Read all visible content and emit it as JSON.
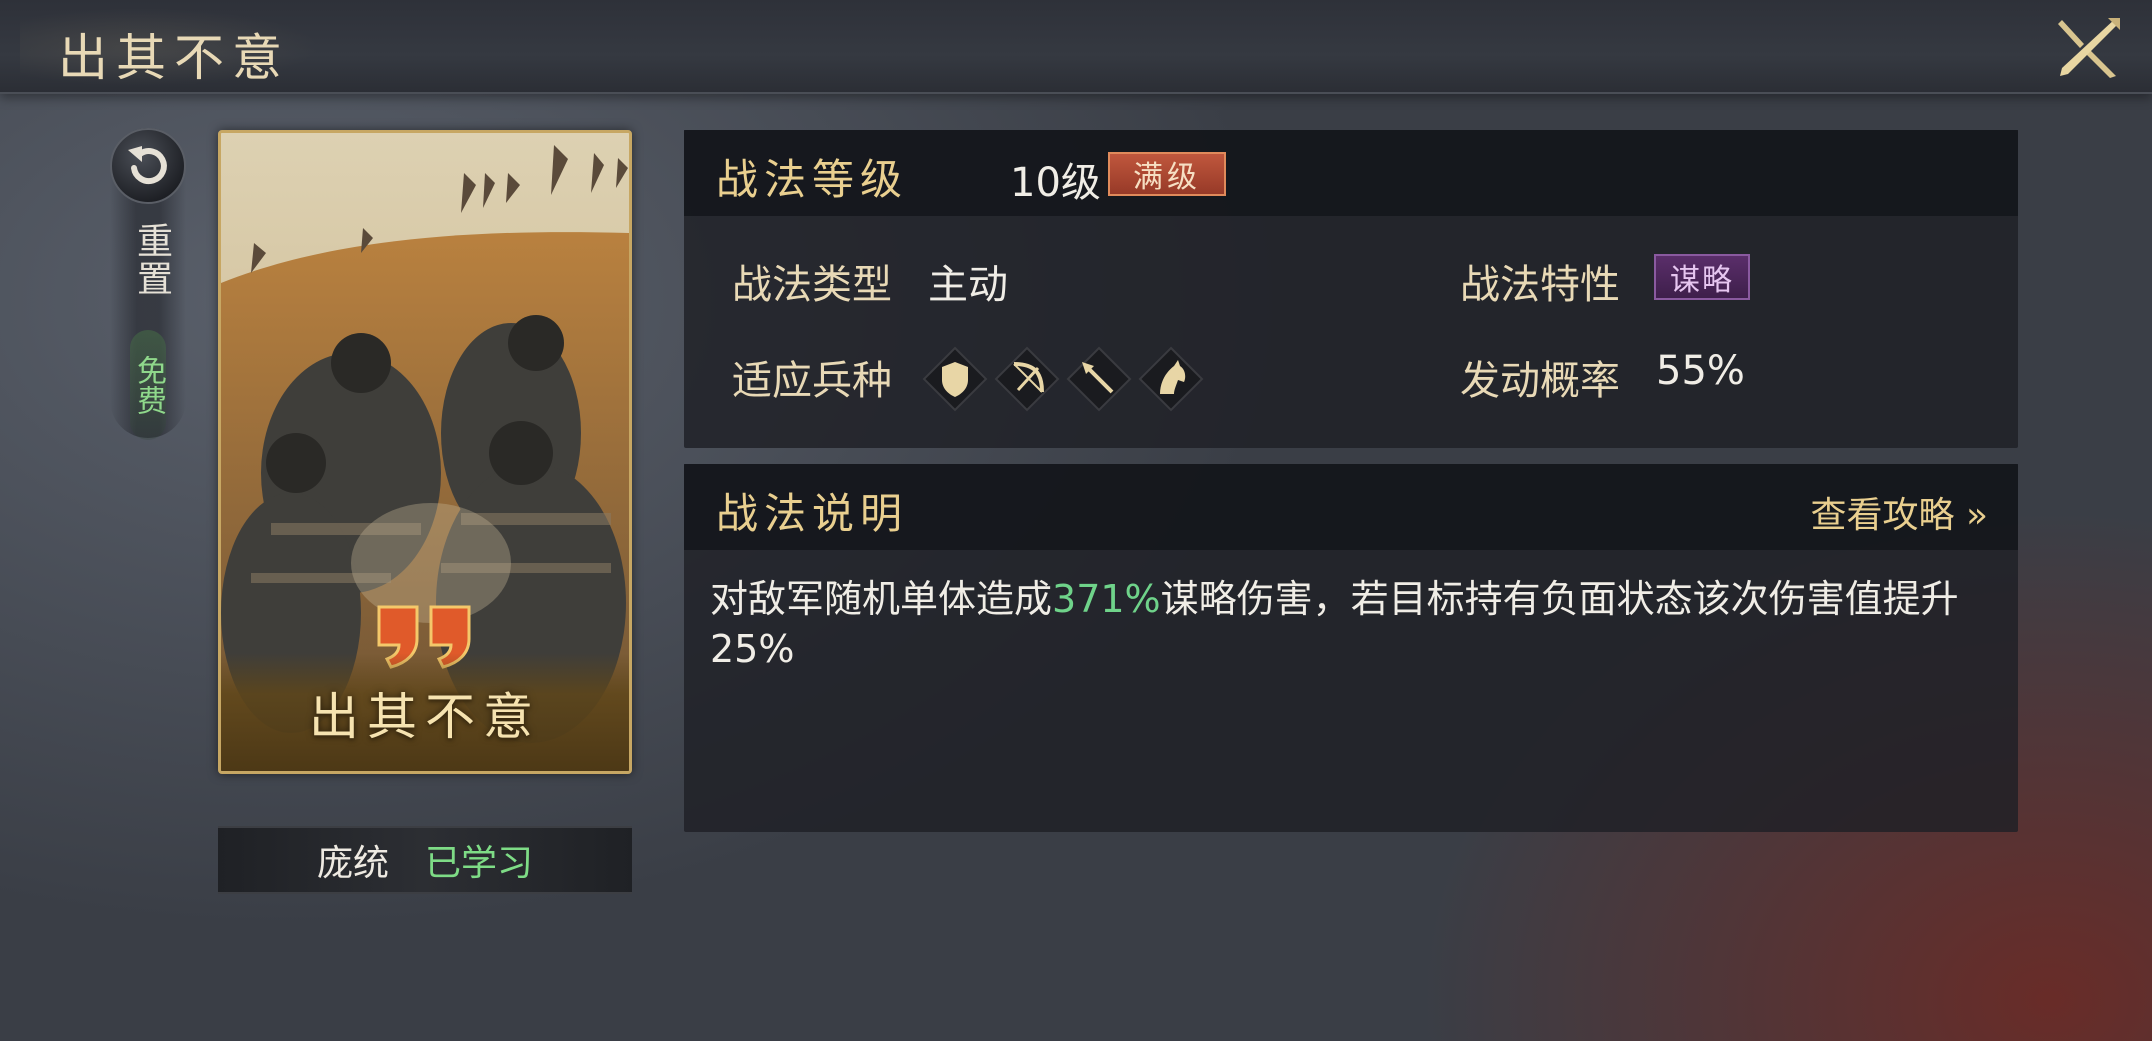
{
  "header": {
    "title": "出其不意"
  },
  "reset": {
    "label": "重置",
    "free_label": "免费"
  },
  "card": {
    "name": "出其不意",
    "owner": "庞统",
    "status": "已学习"
  },
  "level_panel": {
    "title": "战法等级",
    "level": "10级",
    "maxed": "满级",
    "type_label": "战法类型",
    "type_value": "主动",
    "trait_label": "战法特性",
    "trait_value": "谋略",
    "troops_label": "适应兵种",
    "troops": [
      "shield-icon",
      "bow-icon",
      "spear-icon",
      "horse-icon"
    ],
    "rate_label": "发动概率",
    "rate_value": "55%"
  },
  "desc_panel": {
    "title": "战法说明",
    "guide_link": "查看攻略 »",
    "text_before": "对敌军随机单体造成",
    "highlight": "371%",
    "text_after": "谋略伤害，若目标持有负面状态该次伤害值提升25%"
  },
  "colors": {
    "gold": "#e9cf8f",
    "green": "#6fd38a",
    "maxed_red": "#c0573d",
    "trait_purple": "#5a2e6a"
  }
}
